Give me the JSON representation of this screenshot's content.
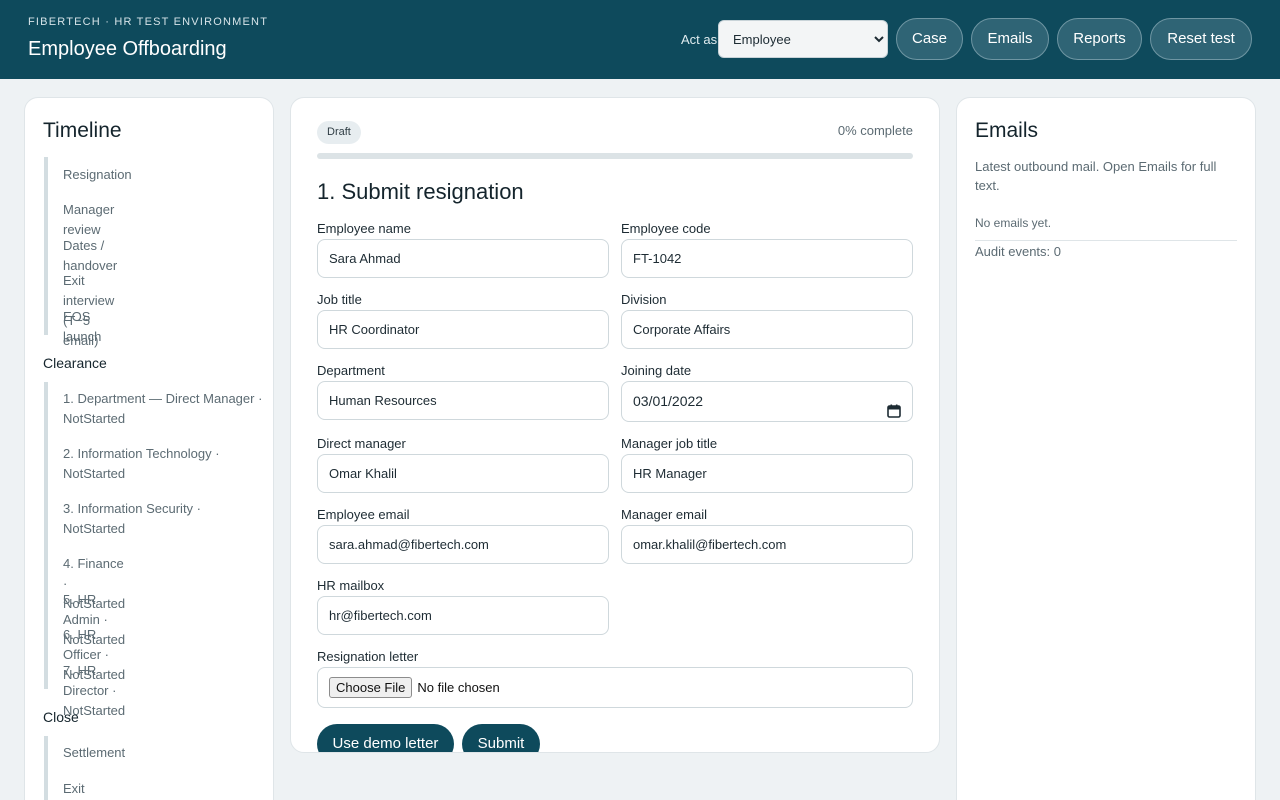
{
  "header": {
    "subtitle": "FIBERTECH · HR TEST ENVIRONMENT",
    "title": "Employee Offboarding",
    "act_as_label": "Act as",
    "role_selected": "Employee",
    "buttons": {
      "case": "Case",
      "emails": "Emails",
      "reports": "Reports",
      "reset": "Reset test"
    }
  },
  "timeline": {
    "title": "Timeline",
    "items": [
      "Resignation",
      "Manager review",
      "Dates / handover",
      "Exit interview (T−5 email)",
      "EOS launch"
    ],
    "clearance": {
      "title": "Clearance",
      "items": [
        "1. Department — Direct Manager · NotStarted",
        "2. Information Technology · NotStarted",
        "3. Information Security · NotStarted",
        "4. Finance · NotStarted",
        "5. HR Admin · NotStarted",
        "6. HR Officer · NotStarted",
        "7. HR Director · NotStarted"
      ]
    },
    "close": {
      "title": "Close",
      "items": [
        "Settlement",
        "Exit documents"
      ]
    }
  },
  "form": {
    "status_badge": "Draft",
    "progress_label": "0% complete",
    "progress_value": 0,
    "step_title": "1. Submit resignation",
    "fields": {
      "employee_name": {
        "label": "Employee name",
        "value": "Sara Ahmad"
      },
      "employee_code": {
        "label": "Employee code",
        "value": "FT-1042"
      },
      "job_title": {
        "label": "Job title",
        "value": "HR Coordinator"
      },
      "division": {
        "label": "Division",
        "value": "Corporate Affairs"
      },
      "department": {
        "label": "Department",
        "value": "Human Resources"
      },
      "joining_date": {
        "label": "Joining date",
        "value": "03/01/2022"
      },
      "direct_manager": {
        "label": "Direct manager",
        "value": "Omar Khalil"
      },
      "manager_job_title": {
        "label": "Manager job title",
        "value": "HR Manager"
      },
      "employee_email": {
        "label": "Employee email",
        "value": "sara.ahmad@fibertech.com"
      },
      "manager_email": {
        "label": "Manager email",
        "value": "omar.khalil@fibertech.com"
      },
      "hr_mailbox": {
        "label": "HR mailbox",
        "value": "hr@fibertech.com"
      }
    },
    "resignation_letter": {
      "label": "Resignation letter",
      "button": "Choose File",
      "status": "No file chosen"
    },
    "actions": {
      "demo_letter": "Use demo letter",
      "submit": "Submit"
    }
  },
  "emails": {
    "title": "Emails",
    "description": "Latest outbound mail. Open Emails for full text.",
    "empty": "No emails yet.",
    "audit": "Audit events: 0"
  },
  "colors": {
    "header_bg": "#0e4a5c",
    "accent": "#0e4a5c",
    "page_bg": "#eef2f4"
  }
}
